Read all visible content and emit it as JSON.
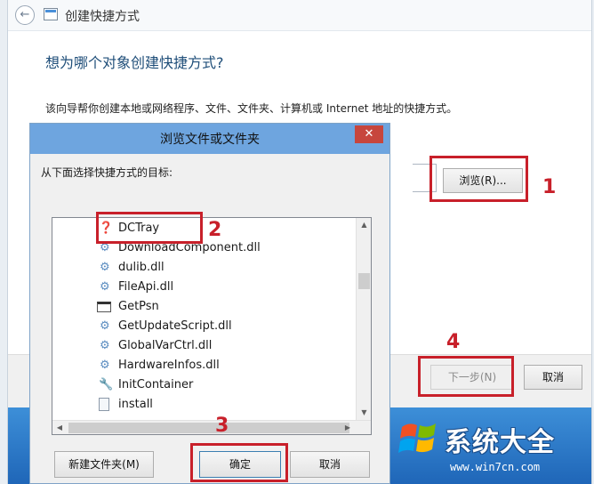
{
  "wizard": {
    "title": "创建快捷方式",
    "heading": "想为哪个对象创建快捷方式?",
    "description": "该向导帮你创建本地或网络程序、文件、文件夹、计算机或 Internet 地址的快捷方式。",
    "browse_label": "浏览(R)...",
    "next_label": "下一步(N)",
    "cancel_label": "取消"
  },
  "dialog": {
    "title": "浏览文件或文件夹",
    "close_label": "✕",
    "prompt": "从下面选择快捷方式的目标:",
    "items": [
      {
        "label": "DCTray",
        "icon": "app-icon"
      },
      {
        "label": "DownloadComponent.dll",
        "icon": "dll-file-icon"
      },
      {
        "label": "dulib.dll",
        "icon": "dll-file-icon"
      },
      {
        "label": "FileApi.dll",
        "icon": "dll-file-icon"
      },
      {
        "label": "GetPsn",
        "icon": "window-icon"
      },
      {
        "label": "GetUpdateScript.dll",
        "icon": "dll-file-icon"
      },
      {
        "label": "GlobalVarCtrl.dll",
        "icon": "dll-file-icon"
      },
      {
        "label": "HardwareInfos.dll",
        "icon": "dll-file-icon"
      },
      {
        "label": "InitContainer",
        "icon": "app-icon"
      },
      {
        "label": "install",
        "icon": "file-icon"
      }
    ],
    "new_folder_label": "新建文件夹(M)",
    "ok_label": "确定",
    "cancel_label": "取消"
  },
  "annotations": [
    "1",
    "2",
    "3",
    "4"
  ],
  "watermark": {
    "text": "系统大全",
    "url": "www.win7cn.com"
  },
  "colors": {
    "highlight": "#c8202a",
    "heading": "#1f4e79",
    "dialog_title": "#6ea5df",
    "close_button": "#c7463d"
  }
}
